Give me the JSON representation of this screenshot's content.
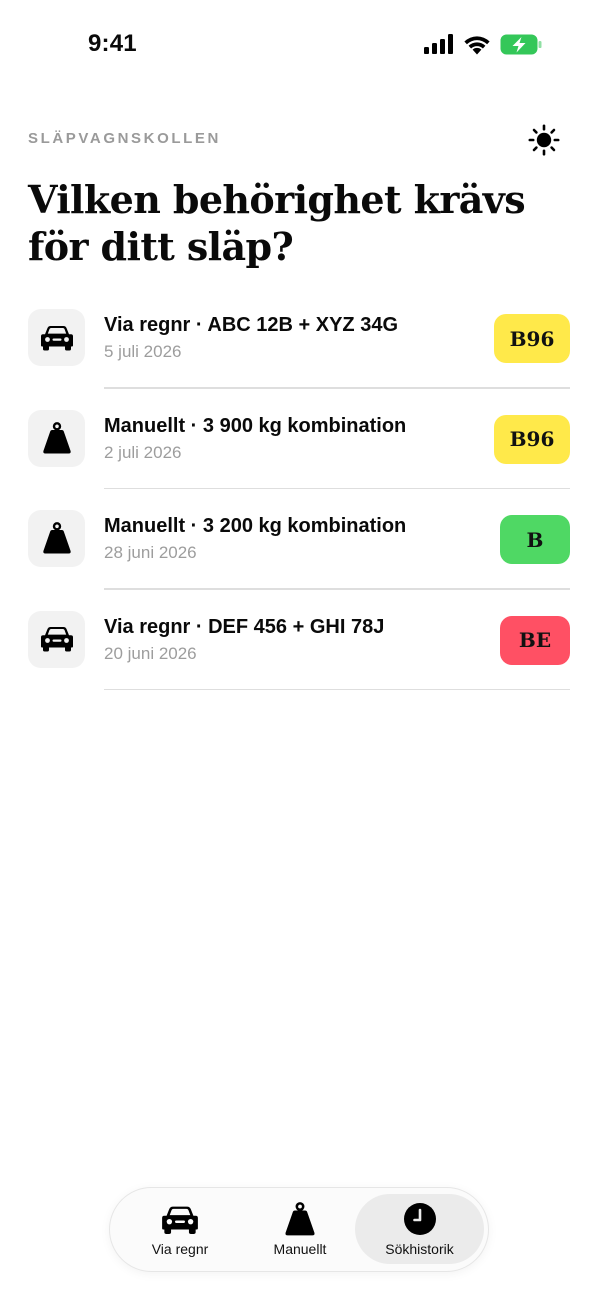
{
  "status_bar": {
    "time": "9:41",
    "icons": [
      "signal-icon",
      "wifi-icon",
      "battery-charging-icon"
    ],
    "battery_color": "#34c759"
  },
  "header": {
    "app_name": "SLÄPVAGNSKOLLEN",
    "theme_icon": "sun-icon",
    "title": "Vilken behörighet krävs för ditt släp?"
  },
  "history": [
    {
      "icon": "car-icon",
      "title": "Via regnr · ABC 12B + XYZ 34G",
      "date": "5 juli 2026",
      "badge": "B96",
      "badge_color": "#ffe94a"
    },
    {
      "icon": "weight-icon",
      "title": "Manuellt · 3 900 kg kombination",
      "date": "2 juli 2026",
      "badge": "B96",
      "badge_color": "#ffe94a"
    },
    {
      "icon": "weight-icon",
      "title": "Manuellt · 3 200 kg kombination",
      "date": "28 juni 2026",
      "badge": "B",
      "badge_color": "#4fd864"
    },
    {
      "icon": "car-icon",
      "title": "Via regnr · DEF 456 + GHI 78J",
      "date": "20 juni 2026",
      "badge": "BE",
      "badge_color": "#ff5064"
    }
  ],
  "tab_bar": {
    "active": "Sökhistorik",
    "tabs": [
      {
        "label": "Via regnr",
        "icon": "car-icon"
      },
      {
        "label": "Manuellt",
        "icon": "weight-icon"
      },
      {
        "label": "Sökhistorik",
        "icon": "clock-icon"
      }
    ]
  }
}
